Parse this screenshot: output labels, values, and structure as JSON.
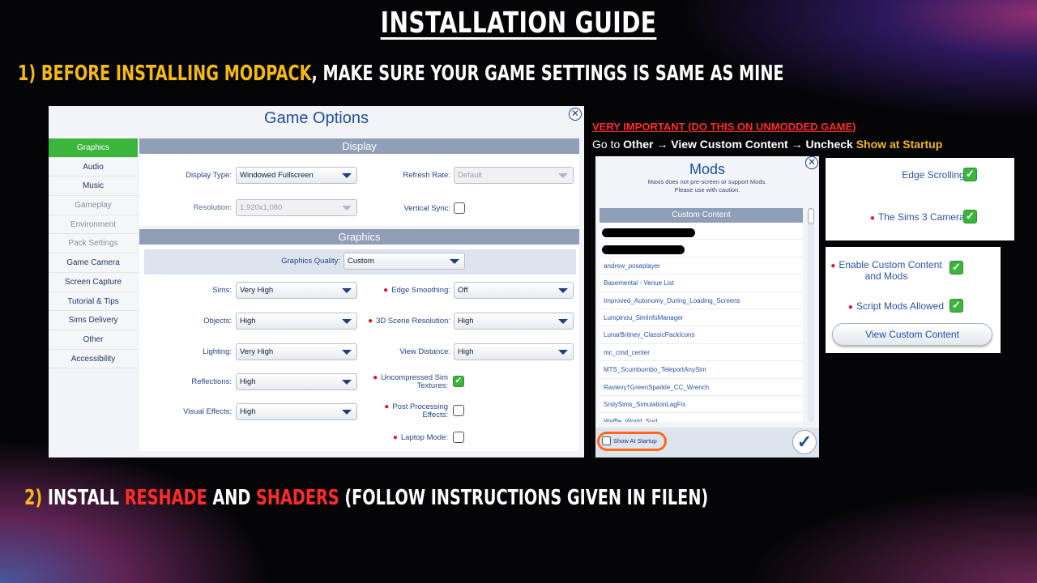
{
  "heading": "Installation Guide",
  "step1": {
    "num": "1) ",
    "highlight": "Before installing modpack",
    "rest": ", make sure your game settings is same as mine"
  },
  "step2": {
    "num": "2) ",
    "t1": "Install ",
    "reshade": "Reshade",
    "t2": " and ",
    "shaders": "Shaders",
    "t3": " (follow instructions given in filen)"
  },
  "game_options": {
    "title": "Game Options",
    "close": "✕",
    "sidebar": [
      "Graphics",
      "Audio",
      "Music",
      "Gameplay",
      "Environment",
      "Pack Settings",
      "Game Camera",
      "Screen Capture",
      "Tutorial & Tips",
      "Sims Delivery",
      "Other",
      "Accessibility"
    ],
    "display_header": "Display",
    "graphics_header": "Graphics",
    "display_type_label": "Display Type:",
    "display_type_value": "Windowed Fullscreen",
    "refresh_rate_label": "Refresh Rate:",
    "refresh_rate_value": "Default",
    "resolution_label": "Resolution:",
    "resolution_value": "1,920x1,080",
    "vsync_label": "Vertical Sync:",
    "quality_label": "Graphics Quality:",
    "quality_value": "Custom",
    "sims_label": "Sims:",
    "sims_value": "Very High",
    "edge_label": "Edge Smoothing:",
    "edge_value": "Off",
    "objects_label": "Objects:",
    "objects_value": "High",
    "scene_label": "3D Scene Resolution:",
    "scene_value": "High",
    "lighting_label": "Lighting:",
    "lighting_value": "Very High",
    "view_label": "View Distance:",
    "view_value": "High",
    "reflections_label": "Reflections:",
    "reflections_value": "High",
    "uncompressed_label1": "Uncompressed Sim",
    "uncompressed_label2": "Textures:",
    "visual_label": "Visual Effects:",
    "visual_value": "High",
    "post_label1": "Post Processing",
    "post_label2": "Effects:",
    "laptop_label": "Laptop Mode:"
  },
  "very_important": "VERY IMPORTANT (DO THIS ON UNMODDED GAME)",
  "instruction": {
    "go": "Go to ",
    "other": "Other",
    "arrow": " → ",
    "vcc": "View Custom Content",
    "uncheck": "Uncheck ",
    "show": "Show at Startup"
  },
  "mods": {
    "title": "Mods",
    "note1": "Maxis does not pre-screen or support Mods.",
    "note2": "Please use with caution.",
    "list_header": "Custom Content",
    "items": [
      "andrew_poseplayer",
      "Basemental - Venue List",
      "Improved_Autonomy_During_Loading_Screens",
      "Lumpinou_SimInfoManager",
      "LunarBritney_ClassicPackIcons",
      "mc_cmd_center",
      "MTS_Scumbumbo_TeleportAnySim",
      "Ravievy†GreenSparkle_CC_Wrench",
      "SrslySims_SimulationLagFix",
      "Waffle_World_Sort"
    ],
    "show_startup": "Show At Startup",
    "confirm": "✓"
  },
  "camera_box": {
    "edge_scrolling": "Edge Scrolling:",
    "sims3_camera": "The Sims 3 Camera:",
    "check": "✓"
  },
  "cc_box": {
    "enable_cc1": "Enable Custom Content",
    "enable_cc2": "and Mods",
    "script_mods": "Script Mods Allowed",
    "button": "View Custom Content",
    "check": "✓"
  }
}
